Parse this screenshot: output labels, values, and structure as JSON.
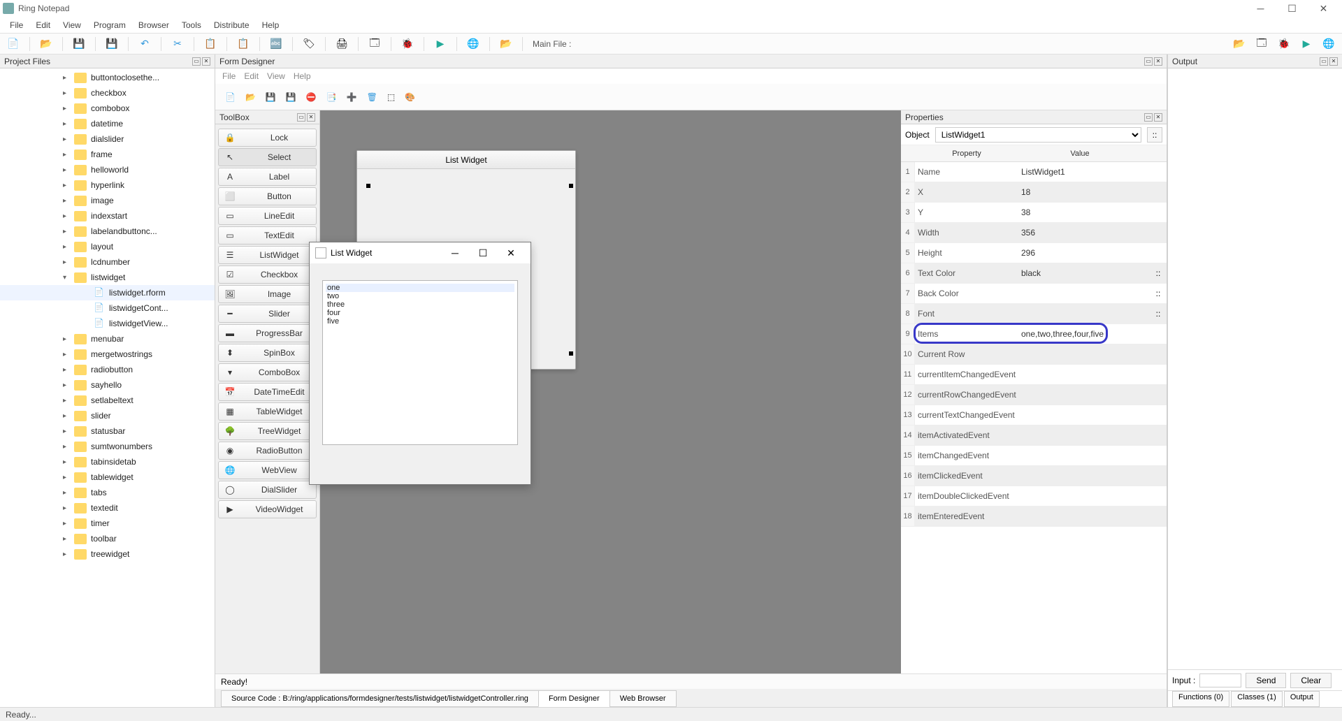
{
  "window": {
    "title": "Ring Notepad"
  },
  "menu": [
    "File",
    "Edit",
    "View",
    "Program",
    "Browser",
    "Tools",
    "Distribute",
    "Help"
  ],
  "main_file_label": "Main File :",
  "project_files_title": "Project Files",
  "form_designer_title": "Form Designer",
  "fd_menu": [
    "File",
    "Edit",
    "View",
    "Help"
  ],
  "toolbox_title": "ToolBox",
  "properties_title": "Properties",
  "output_title": "Output",
  "tree": [
    {
      "t": "buttontoclosethe...",
      "f": true
    },
    {
      "t": "checkbox",
      "f": true
    },
    {
      "t": "combobox",
      "f": true
    },
    {
      "t": "datetime",
      "f": true
    },
    {
      "t": "dialslider",
      "f": true
    },
    {
      "t": "frame",
      "f": true
    },
    {
      "t": "helloworld",
      "f": true
    },
    {
      "t": "hyperlink",
      "f": true
    },
    {
      "t": "image",
      "f": true
    },
    {
      "t": "indexstart",
      "f": true
    },
    {
      "t": "labelandbuttonc...",
      "f": true
    },
    {
      "t": "layout",
      "f": true
    },
    {
      "t": "lcdnumber",
      "f": true
    },
    {
      "t": "listwidget",
      "f": true,
      "open": true,
      "children": [
        {
          "t": "listwidget.rform",
          "sel": true
        },
        {
          "t": "listwidgetCont..."
        },
        {
          "t": "listwidgetView..."
        }
      ]
    },
    {
      "t": "menubar",
      "f": true
    },
    {
      "t": "mergetwostrings",
      "f": true
    },
    {
      "t": "radiobutton",
      "f": true
    },
    {
      "t": "sayhello",
      "f": true
    },
    {
      "t": "setlabeltext",
      "f": true
    },
    {
      "t": "slider",
      "f": true
    },
    {
      "t": "statusbar",
      "f": true
    },
    {
      "t": "sumtwonumbers",
      "f": true
    },
    {
      "t": "tabinsidetab",
      "f": true
    },
    {
      "t": "tablewidget",
      "f": true
    },
    {
      "t": "tabs",
      "f": true
    },
    {
      "t": "textedit",
      "f": true
    },
    {
      "t": "timer",
      "f": true
    },
    {
      "t": "toolbar",
      "f": true
    },
    {
      "t": "treewidget",
      "f": true
    }
  ],
  "tools": [
    "Lock",
    "Select",
    "Label",
    "Button",
    "LineEdit",
    "TextEdit",
    "ListWidget",
    "Checkbox",
    "Image",
    "Slider",
    "ProgressBar",
    "SpinBox",
    "ComboBox",
    "DateTimeEdit",
    "TableWidget",
    "TreeWidget",
    "RadioButton",
    "WebView",
    "DialSlider",
    "VideoWidget"
  ],
  "tool_selected": "Select",
  "form_window_title": "List Widget",
  "popup": {
    "title": "List Widget",
    "items": [
      "one",
      "two",
      "three",
      "four",
      "five"
    ],
    "selected": "one"
  },
  "object_label": "Object",
  "object_value": "ListWidget1",
  "prop_headers": {
    "p": "Property",
    "v": "Value"
  },
  "properties": [
    {
      "n": "Name",
      "v": "ListWidget1"
    },
    {
      "n": "X",
      "v": "18"
    },
    {
      "n": "Y",
      "v": "38"
    },
    {
      "n": "Width",
      "v": "356"
    },
    {
      "n": "Height",
      "v": "296"
    },
    {
      "n": "Text Color",
      "v": "black",
      "e": true
    },
    {
      "n": "Back Color",
      "v": "",
      "e": true
    },
    {
      "n": "Font",
      "v": "",
      "e": true
    },
    {
      "n": "Items",
      "v": "one,two,three,four,five",
      "hl": true
    },
    {
      "n": "Current Row",
      "v": ""
    },
    {
      "n": "currentItemChangedEvent",
      "v": ""
    },
    {
      "n": "currentRowChangedEvent",
      "v": ""
    },
    {
      "n": "currentTextChangedEvent",
      "v": ""
    },
    {
      "n": "itemActivatedEvent",
      "v": ""
    },
    {
      "n": "itemChangedEvent",
      "v": ""
    },
    {
      "n": "itemClickedEvent",
      "v": ""
    },
    {
      "n": "itemDoubleClickedEvent",
      "v": ""
    },
    {
      "n": "itemEnteredEvent",
      "v": ""
    }
  ],
  "fd_ready": "Ready!",
  "fd_status_tabs": [
    {
      "t": "Source Code : B:/ring/applications/formdesigner/tests/listwidget/listwidgetController.ring"
    },
    {
      "t": "Form Designer",
      "active": true
    },
    {
      "t": "Web Browser"
    }
  ],
  "input_label": "Input :",
  "send_label": "Send",
  "clear_label": "Clear",
  "output_tabs": [
    "Functions (0)",
    "Classes (1)",
    "Output"
  ],
  "status": "Ready..."
}
